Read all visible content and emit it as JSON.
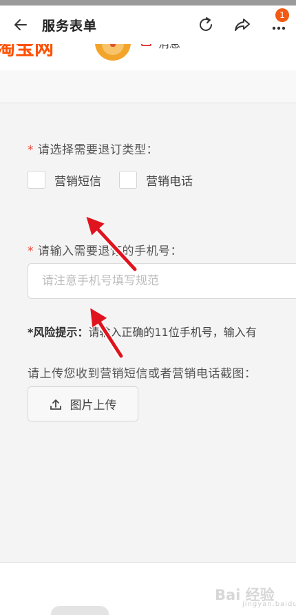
{
  "header": {
    "title": "服务表单",
    "badge_count": "1",
    "icons": [
      "back-arrow-icon",
      "refresh-icon",
      "share-icon",
      "more-icon"
    ]
  },
  "underlay": {
    "logo_text": "淘宝网",
    "message_label": "消息"
  },
  "form": {
    "type_question": "请选择需要退订类型：",
    "required_mark": "*",
    "options": [
      {
        "label": "营销短信",
        "checked": false
      },
      {
        "label": "营销电话",
        "checked": false
      }
    ],
    "phone_question": "请输入需要退订的手机号：",
    "phone_placeholder": "请注意手机号填写规范",
    "phone_value": "",
    "risk_title": "*风险提示：",
    "risk_text": "请输入正确的11位手机号，输入有",
    "upload_prompt": "请上传您收到营销短信或者营销电话截图：",
    "upload_button": "图片上传"
  },
  "watermark": {
    "text": "Bai 经验",
    "sub": "jingyan.baidu.com"
  },
  "colors": {
    "accent": "#ff5000",
    "required": "#e94b3c",
    "annotation_arrow": "#e0141e"
  }
}
